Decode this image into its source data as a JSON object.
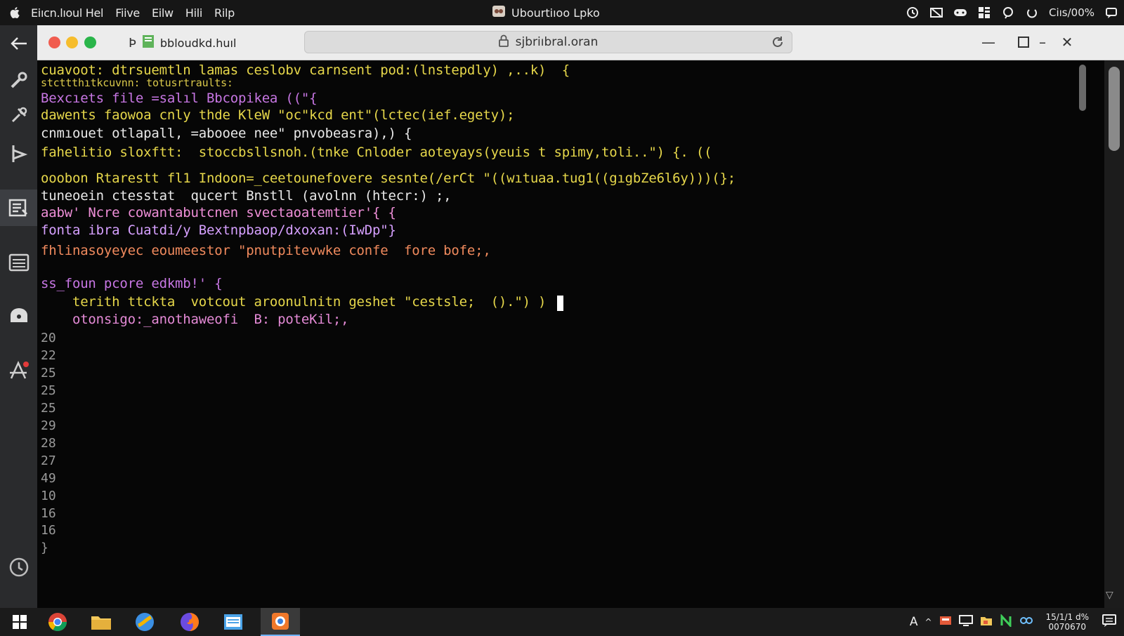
{
  "menubar": {
    "app_menu": "Eiıcn.lıoul Hel",
    "menus": [
      "Fiive",
      "Eilw",
      "Hili",
      "Rilp"
    ],
    "window_title": "Ubourtiıoo Lpko",
    "battery": "Ciıs/00%"
  },
  "browser": {
    "tab_title": "bbloudkd.huıl",
    "address": "sjbriıbral.oran"
  },
  "editor": {
    "code_lines": [
      {
        "text": "cuavoot: dtrsuemtln lamas ceslobv carnsent pod:(lnstepdly) ,..k)  {",
        "color": "#e6d74a"
      },
      {
        "text": "stcttthıtkcuvnn: totusrtraults:",
        "color": "#d9c84a"
      },
      {
        "text": "Bexcıets file =salıl Bbcopikea ((\"{",
        "color": "#c776e3"
      },
      {
        "text": "dawents faowoa cnly thde KleW \"oc\"kcd ent\"(lctec(ief.egety);",
        "color": "#e6d74a"
      },
      {
        "text": "cnmıouet otlapall, =abooee nee\" pnvobeasra),) {",
        "color": "#e8e8e8"
      },
      {
        "text": "fahelitio sloxftt:  stoccbsllsnoh.(tnke Cnloder aoteyays(yeuis t spimy,toli..\") {. ((",
        "color": "#e6d74a"
      },
      {
        "text": "ooobon Rtarestt fl1 Indoon=_ceetounefovere sesnte(/erCt \"((wıtuaa.tug1((gıgbZe6l6y)))(};",
        "color": "#e6d74a"
      },
      {
        "text": "tuneoein ctesstat  qucert Bnstll (avolnn (htecr:) ;,",
        "color": "#e8e8e8"
      },
      {
        "text": "aabw' Ncre cowantabutcnen svectaoatemtier'{ {",
        "color": "#ef8fd8"
      },
      {
        "text": "fonta ibra Cuatdi/y Bextnpbaop/dxoxan:(IwDp\"}",
        "color": "#d6a0ff"
      },
      {
        "text": "fhlinasoyeyec eoumeestor \"pnutpitevwke confe  fore bofe;,",
        "color": "#f08a5d"
      },
      {
        "text": "ss_foun pcore edkmb!' {",
        "color": "#c776e3"
      },
      {
        "text": "    terith ttckta  votcout aroonulnitn geshet \"cestsle;  ().\") )",
        "color": "#e6d74a"
      },
      {
        "text": "    otonsigo:_anothaweofi  B: poteKil;,",
        "color": "#e48ad6"
      }
    ],
    "line_numbers": [
      "20",
      "22",
      "25",
      "25",
      "25",
      "29",
      "28",
      "27",
      "49",
      "10",
      "16",
      "16",
      "}"
    ]
  },
  "taskbar": {
    "clock_time": "15/1/1 d%",
    "clock_date": "0070670"
  },
  "colors": {
    "keyword_yellow": "#e6d74a",
    "keyword_purple": "#c776e3",
    "string_orange": "#f08a5d",
    "background": "#060606"
  }
}
